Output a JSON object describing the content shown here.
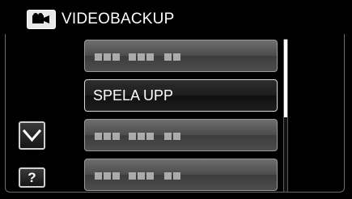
{
  "header": {
    "icon": "video-camera-icon",
    "title": "VIDEOBACKUP"
  },
  "menu": {
    "items": [
      {
        "label": "",
        "state": "disabled-placeholder"
      },
      {
        "label": "SPELA UPP",
        "state": "selected"
      },
      {
        "label": "",
        "state": "disabled-placeholder"
      },
      {
        "label": "",
        "state": "disabled-placeholder"
      }
    ]
  },
  "controls": {
    "scroll_down_icon": "chevron-down-icon",
    "help_label": "?"
  },
  "colors": {
    "background": "#000000",
    "text": "#ffffff",
    "item_border": "#9a9a9a"
  }
}
